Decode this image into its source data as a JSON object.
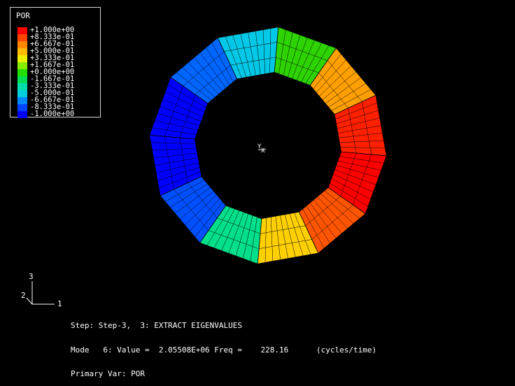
{
  "legend": {
    "title": "POR",
    "entries": [
      {
        "label": "+1.000e+00",
        "color": "#ff0000"
      },
      {
        "label": "+8.333e-01",
        "color": "#ff4400"
      },
      {
        "label": "+6.667e-01",
        "color": "#ff8800"
      },
      {
        "label": "+5.000e-01",
        "color": "#ffbb00"
      },
      {
        "label": "+3.333e-01",
        "color": "#eeee00"
      },
      {
        "label": "+1.667e-01",
        "color": "#88ee00"
      },
      {
        "label": "+0.000e+00",
        "color": "#22dd00"
      },
      {
        "label": "-1.667e-01",
        "color": "#00dd55"
      },
      {
        "label": "-3.333e-01",
        "color": "#00ddaa"
      },
      {
        "label": "-5.000e-01",
        "color": "#00ccdd"
      },
      {
        "label": "-6.667e-01",
        "color": "#0088ff"
      },
      {
        "label": "-8.333e-01",
        "color": "#0044ff"
      },
      {
        "label": "-1.000e+00",
        "color": "#0000ff"
      }
    ]
  },
  "triad": {
    "axis_1": "1",
    "axis_2": "2",
    "axis_3": "3"
  },
  "view_axes": {
    "y_label": "Y",
    "x_label": "X"
  },
  "info": {
    "line1": "Step: Step-3,  3: EXTRACT EIGENVALUES",
    "line2": "Mode   6: Value =  2.05508E+06 Freq =    228.16      (cycles/time)",
    "line3": "Primary Var: POR"
  },
  "model": {
    "segment_count": 12,
    "segment_colors": [
      "#00c8e6",
      "#2ed400",
      "#ffa000",
      "#ff2000",
      "#ff0000",
      "#ff5500",
      "#ffd000",
      "#00e08a",
      "#0050ff",
      "#0000ff",
      "#0000ff",
      "#0066ff"
    ]
  }
}
